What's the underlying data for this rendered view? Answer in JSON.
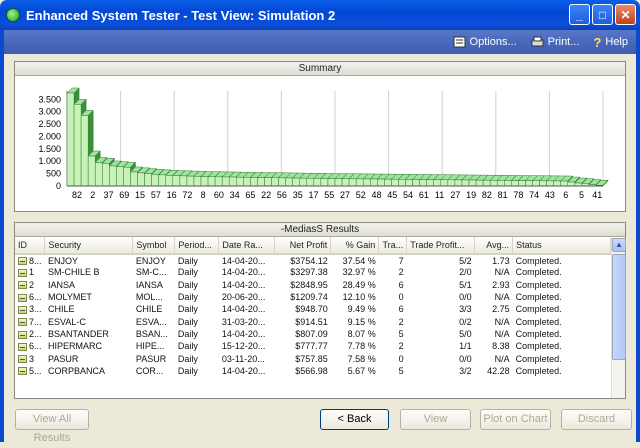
{
  "window": {
    "title": "Enhanced System Tester - Test View: Simulation 2"
  },
  "toolbar": {
    "options": "Options...",
    "print": "Print...",
    "help": "Help"
  },
  "summary": {
    "header": "Summary"
  },
  "chart_data": {
    "type": "bar",
    "yticks": [
      "3.500",
      "3.000",
      "2.500",
      "2.000",
      "1.500",
      "1.000",
      "500",
      "0"
    ],
    "ylim": [
      0,
      3754.12
    ],
    "xlabels": [
      "82",
      "2",
      "37",
      "69",
      "15",
      "57",
      "16",
      "72",
      "8",
      "60",
      "34",
      "65",
      "22",
      "56",
      "35",
      "17",
      "55",
      "27",
      "52",
      "48",
      "45",
      "54",
      "61",
      "11",
      "27",
      "19",
      "82",
      "81",
      "78",
      "74",
      "43",
      "6",
      "5",
      "41"
    ],
    "values": [
      3754.12,
      3297.38,
      2848.95,
      1209.74,
      948.7,
      914.51,
      807.09,
      777.77,
      757.85,
      566.98,
      530,
      500,
      470,
      450,
      430,
      420,
      410,
      400,
      390,
      380,
      375,
      370,
      365,
      360,
      355,
      350,
      345,
      340,
      336,
      332,
      328,
      324,
      320,
      316,
      312,
      308,
      304,
      300,
      297,
      294,
      291,
      288,
      285,
      282,
      279,
      276,
      273,
      270,
      267,
      264,
      261,
      258,
      255,
      252,
      249,
      246,
      243,
      240,
      237,
      234,
      231,
      228,
      225,
      222,
      219,
      216,
      213,
      210,
      207,
      204,
      200,
      160,
      120,
      90,
      60,
      30
    ]
  },
  "results": {
    "header": "-MediasS Results",
    "columns": [
      "ID",
      "Security",
      "Symbol",
      "Period...",
      "Date Ra...",
      "Net Profit",
      "% Gain",
      "Tra...",
      "Trade Profit...",
      "Avg...",
      "Status"
    ],
    "rows": [
      [
        "8...",
        "ENJOY",
        "ENJOY",
        "Daily",
        "14-04-20...",
        "$3754.12",
        "37.54 %",
        "7",
        "5/2",
        "1.73",
        "Completed."
      ],
      [
        "1",
        "SM-CHILE B",
        "SM-C...",
        "Daily",
        "14-04-20...",
        "$3297.38",
        "32.97 %",
        "2",
        "2/0",
        "N/A",
        "Completed."
      ],
      [
        "2",
        "IANSA",
        "IANSA",
        "Daily",
        "14-04-20...",
        "$2848.95",
        "28.49 %",
        "6",
        "5/1",
        "2.93",
        "Completed."
      ],
      [
        "6...",
        "MOLYMET",
        "MOL...",
        "Daily",
        "20-06-20...",
        "$1209.74",
        "12.10 %",
        "0",
        "0/0",
        "N/A",
        "Completed."
      ],
      [
        "3...",
        "CHILE",
        "CHILE",
        "Daily",
        "14-04-20...",
        "$948.70",
        "9.49 %",
        "6",
        "3/3",
        "2.75",
        "Completed."
      ],
      [
        "7...",
        "ESVAL-C",
        "ESVA...",
        "Daily",
        "31-03-20...",
        "$914.51",
        "9.15 %",
        "2",
        "0/2",
        "N/A",
        "Completed."
      ],
      [
        "2...",
        "BSANTANDER",
        "BSAN...",
        "Daily",
        "14-04-20...",
        "$807.09",
        "8.07 %",
        "5",
        "5/0",
        "N/A",
        "Completed."
      ],
      [
        "6...",
        "HIPERMARC",
        "HIPE...",
        "Daily",
        "15-12-20...",
        "$777.77",
        "7.78 %",
        "2",
        "1/1",
        "8.38",
        "Completed."
      ],
      [
        "3",
        "PASUR",
        "PASUR",
        "Daily",
        "03-11-20...",
        "$757.85",
        "7.58 %",
        "0",
        "0/0",
        "N/A",
        "Completed."
      ],
      [
        "5...",
        "CORPBANCA",
        "COR...",
        "Daily",
        "14-04-20...",
        "$566.98",
        "5.67 %",
        "5",
        "3/2",
        "42.28",
        "Completed."
      ]
    ]
  },
  "buttons": {
    "view_all": "View All Results",
    "back": "< Back",
    "view": "View",
    "plot": "Plot on Chart",
    "discard": "Discard"
  }
}
